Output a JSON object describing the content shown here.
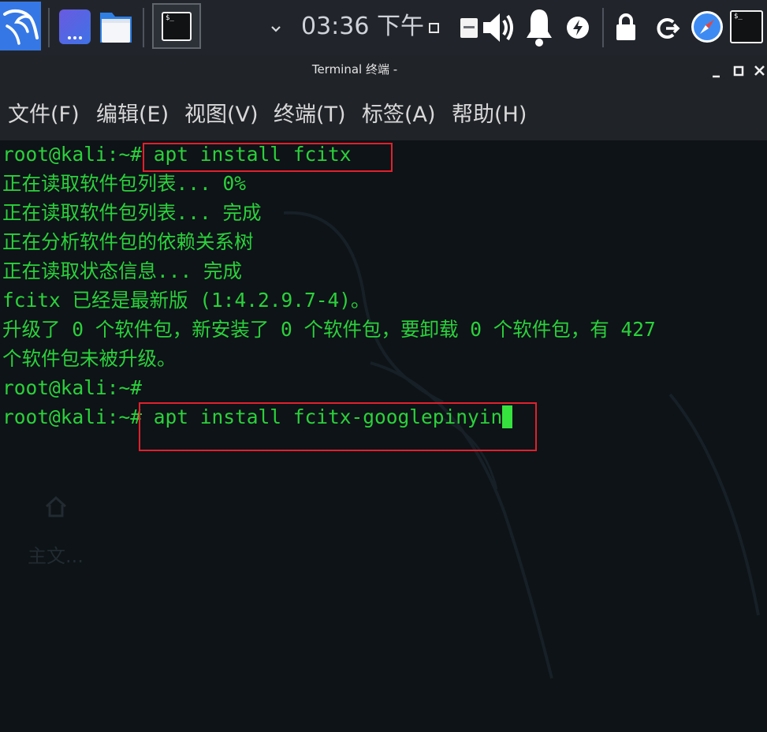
{
  "panel": {
    "clock": "03:36 下午",
    "terminal_glyph": "$_"
  },
  "window": {
    "title": "Terminal 终端 -"
  },
  "menu": {
    "items": [
      {
        "label": "文件(F)"
      },
      {
        "label": "编辑(E)"
      },
      {
        "label": "视图(V)"
      },
      {
        "label": "终端(T)"
      },
      {
        "label": "标签(A)"
      },
      {
        "label": "帮助(H)"
      }
    ]
  },
  "terminal": {
    "lines": [
      "root@kali:~# apt install fcitx",
      "正在读取软件包列表... 0%",
      "正在读取软件包列表... 完成",
      "正在分析软件包的依赖关系树",
      "正在读取状态信息... 完成",
      "fcitx 已经是最新版 (1:4.2.9.7-4)。",
      "升级了 0 个软件包，新安装了 0 个软件包，要卸载 0 个软件包，有 427",
      "个软件包未被升级。",
      "root@kali:~#",
      "root@kali:~# apt install fcitx-googlepinyin"
    ]
  },
  "desktop": {
    "home_folder_label": "主文..."
  },
  "icons": {
    "launcher": "kali-menu-icon",
    "apps": "app-launcher-icon",
    "files": "file-manager-icon",
    "terminal": "terminal-icon",
    "tray": [
      "chevron-down-icon",
      "window-square-icon",
      "keyboard-ctrl-icon",
      "volume-icon",
      "bell-icon",
      "power-icon",
      "lock-icon",
      "logout-icon",
      "browser-compass-icon",
      "terminal-icon"
    ],
    "window_controls": [
      "minimize-icon",
      "maximize-icon",
      "close-icon"
    ]
  },
  "colors": {
    "panel_bg": "#21252b",
    "window_bg": "#202328",
    "terminal_bg": "#0d1317",
    "terminal_text": "#2bd13b",
    "highlight_box": "#e3202c",
    "kali_blue": "#3578e5"
  }
}
